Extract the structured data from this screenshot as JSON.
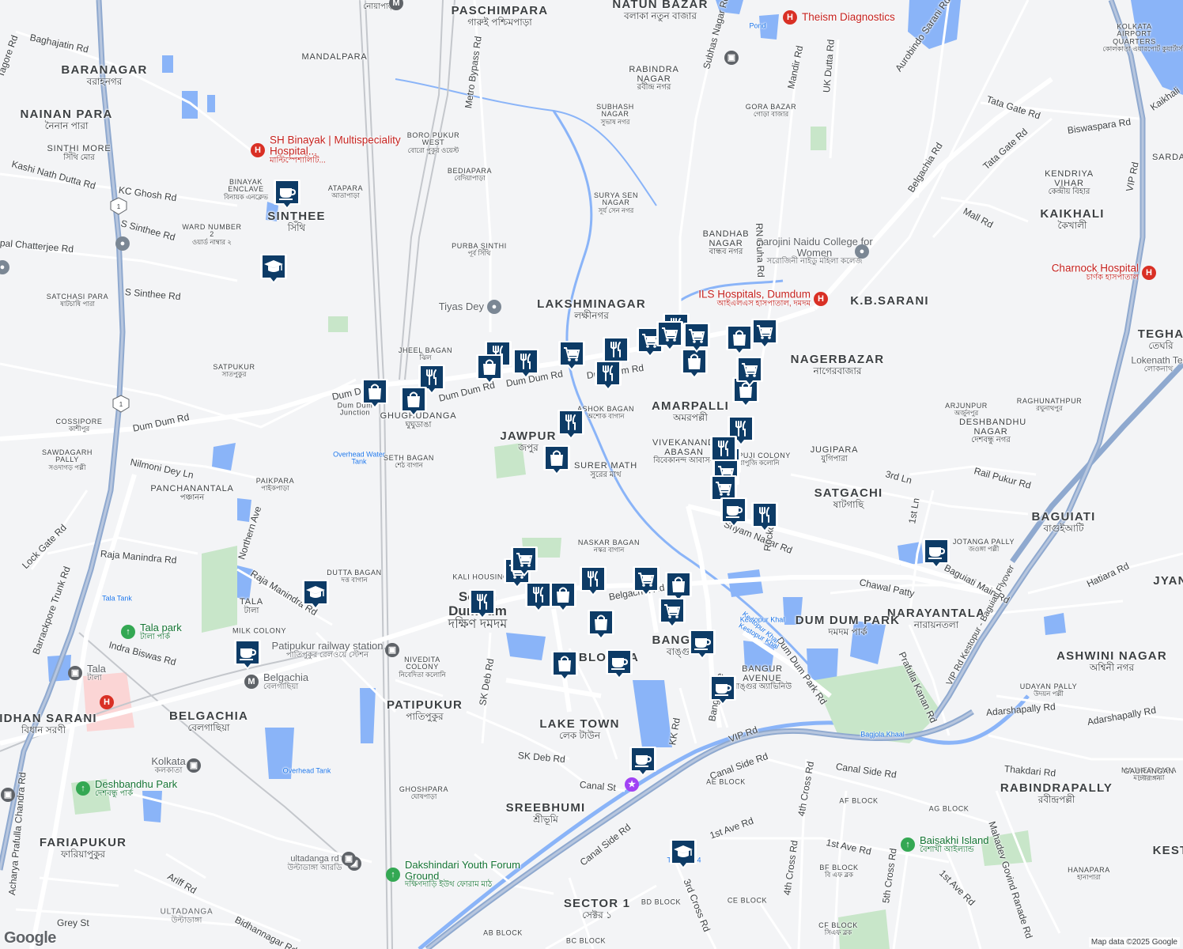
{
  "map": {
    "attribution": "Map data ©2025 Google",
    "logo": "Google",
    "colors": {
      "land": "#f3f4f6",
      "water": "#8ab4f8",
      "park": "#c8e6c9",
      "road": "#ffffff",
      "highway": "#8fa9cf",
      "rail": "#c4c7cc",
      "hospital_area": "#fbd5d5",
      "pin": "#0d3b66"
    }
  },
  "labels": [
    {
      "en": "NOAPARA",
      "bn": "নোয়াপাড়া",
      "cls": "mid"
    },
    {
      "en": "PASCHIMPARA",
      "bn": "গারুই পশ্চিমপাড়া",
      "cls": "big2"
    },
    {
      "en": "NATUN BAZAR",
      "bn": "বলাকা নতুন বাজার",
      "cls": "big"
    },
    {
      "en": "BARANAGAR",
      "bn": "বরাহনগর",
      "cls": "big"
    },
    {
      "en": "MANDALPARA",
      "bn": "",
      "cls": "mid"
    },
    {
      "en": "NAINAN PARA",
      "bn": "নৈনান পারা",
      "cls": "big"
    },
    {
      "en": "SINTHI MORE",
      "bn": "সিঁথি মোর",
      "cls": "mid"
    },
    {
      "en": "BINAYAK ENCLAVE",
      "bn": "বিনায়ক এনক্লেভ",
      "cls": "small"
    },
    {
      "en": "ATAPARA",
      "bn": "আতাপাড়া",
      "cls": "small"
    },
    {
      "en": "SINTHEE",
      "bn": "সিঁথি",
      "cls": "big"
    },
    {
      "en": "WARD NUMBER 2",
      "bn": "ওয়ার্ড নাম্বার ২",
      "cls": "small"
    },
    {
      "en": "SATCHASI PARA",
      "bn": "ষাটচাষি পারা",
      "cls": "small"
    },
    {
      "en": "SATPUKUR",
      "bn": "সাতপুকুর",
      "cls": "small"
    },
    {
      "en": "COSSIPORE",
      "bn": "কাশীপুর",
      "cls": "small"
    },
    {
      "en": "SAWDAGARH PALLY",
      "bn": "সওদাগড় পল্লী",
      "cls": "small"
    },
    {
      "en": "PANCHANANTALA",
      "bn": "পঞ্চানন",
      "cls": "mid"
    },
    {
      "en": "PAIKPARA",
      "bn": "পাইকপাড়া",
      "cls": "small"
    },
    {
      "en": "DUTTA BAGAN",
      "bn": "দত্ত বাগান",
      "cls": "small"
    },
    {
      "en": "TALA",
      "bn": "টালা",
      "cls": "mid"
    },
    {
      "en": "BELGACHIA",
      "bn": "বেলগাছিয়া",
      "cls": "big"
    },
    {
      "en": "BIDHAN SARANI",
      "bn": "বিধান সরণী",
      "cls": "big"
    },
    {
      "en": "FARIAPUKUR",
      "bn": "ফারিয়াপুকুর",
      "cls": "big"
    },
    {
      "en": "PATIPUKUR",
      "bn": "পাতিপুকুর",
      "cls": "big"
    },
    {
      "en": "NIVEDITA COLONY",
      "bn": "নিবেদিতা কলোনি",
      "cls": "small"
    },
    {
      "en": "GHOSHPARA",
      "bn": "ঘোষপাড়া",
      "cls": "small"
    },
    {
      "en": "SREEBHUMI",
      "bn": "শ্রীভূমি",
      "cls": "big"
    },
    {
      "en": "LAKE TOWN",
      "bn": "লেক টাউন",
      "cls": "big"
    },
    {
      "en": "SECTOR 1",
      "bn": "সেক্টর ১",
      "cls": "big"
    },
    {
      "en": "South Dumdum",
      "bn": "দক্ষিণ দমদম",
      "cls": "town"
    },
    {
      "en": "KALI HOUSING",
      "bn": "",
      "cls": "small"
    },
    {
      "en": "NASKAR BAGAN",
      "bn": "নস্কর বাগান",
      "cls": "small"
    },
    {
      "en": "BANGUR AVENUE",
      "bn": "বাঙ্গুর অ্যাভিনিউ",
      "cls": "mid"
    },
    {
      "en": "BLOCK A",
      "bn": "",
      "cls": "big"
    },
    {
      "en": "BANGUR",
      "bn": "বাঙ্গুর",
      "cls": "big"
    },
    {
      "en": "SURER MATH",
      "bn": "সুরের মাথ",
      "cls": "mid"
    },
    {
      "en": "VIVEKANANDA ABASAN",
      "bn": "বিবেকানন্দ আবাসন",
      "cls": "mid"
    },
    {
      "en": "JAWPUR",
      "bn": "জপুর",
      "cls": "big"
    },
    {
      "en": "AMARPALLI",
      "bn": "অমরপল্লী",
      "cls": "big"
    },
    {
      "en": "BAPUJI COLONY",
      "bn": "বাপুজি কলোনি",
      "cls": "small"
    },
    {
      "en": "SATGACHI",
      "bn": "ষাটগাছি",
      "cls": "big"
    },
    {
      "en": "JUGIPARA",
      "bn": "যুগিপারা",
      "cls": "mid"
    },
    {
      "en": "NAGERBAZAR",
      "bn": "নাগেরবাজার",
      "cls": "big"
    },
    {
      "en": "ARJUNPUR",
      "bn": "অর্জুনপুর",
      "cls": "small"
    },
    {
      "en": "K.B.SARANI",
      "bn": "",
      "cls": "big"
    },
    {
      "en": "LAKSHMINAGAR",
      "bn": "লক্ষীনগর",
      "cls": "big"
    },
    {
      "en": "BANDHAB NAGAR",
      "bn": "বান্ধব নগর",
      "cls": "mid"
    },
    {
      "en": "PURBA SINTHI",
      "bn": "পূর্ব সিঁথি",
      "cls": "small"
    },
    {
      "en": "SURYA SEN NAGAR",
      "bn": "সূর্য সেন নগর",
      "cls": "small"
    },
    {
      "en": "BEDIAPARA",
      "bn": "বেদিয়াপাড়া",
      "cls": "small"
    },
    {
      "en": "BORO PUKUR WEST",
      "bn": "বোরো পুকুর ওয়েস্ট",
      "cls": "small"
    },
    {
      "en": "SUBHASH NAGAR",
      "bn": "সুভাষ নগর",
      "cls": "small"
    },
    {
      "en": "RABINDRA NAGAR",
      "bn": "রবীন্দ্র নগর",
      "cls": "mid"
    },
    {
      "en": "GORA BAZAR",
      "bn": "গোড়া বাজার",
      "cls": "small"
    },
    {
      "en": "JHEEL BAGAN",
      "bn": "ঝিল",
      "cls": "small"
    },
    {
      "en": "GHUGHUDANGA",
      "bn": "ঘুঘুডাঙা",
      "cls": "mid"
    },
    {
      "en": "SETH BAGAN",
      "bn": "শেঠ বাগান",
      "cls": "small"
    },
    {
      "en": "ASHOK BAGAN",
      "bn": "অশোক বাগান",
      "cls": "small"
    },
    {
      "en": "RAGHUNATHPUR",
      "bn": "রঘুনাথপুর",
      "cls": "small"
    },
    {
      "en": "DESHBANDHU NAGAR",
      "bn": "দেশবন্ধু নগর",
      "cls": "mid"
    },
    {
      "en": "BAGUIATI",
      "bn": "বাগুইআটি",
      "cls": "big"
    },
    {
      "en": "JOTANGA PALLY",
      "bn": "জওঙ্গা পল্লী",
      "cls": "small"
    },
    {
      "en": "NARAYANTALA",
      "bn": "নারায়নতলা",
      "cls": "big"
    },
    {
      "en": "DUM DUM PARK",
      "bn": "দমদম পার্ক",
      "cls": "big"
    },
    {
      "en": "ASHWINI NAGAR",
      "bn": "অশ্বিনী নগর",
      "cls": "big"
    },
    {
      "en": "UDAYAN PALLY",
      "bn": "উদয়ন পল্লী",
      "cls": "small"
    },
    {
      "en": "RABINDRAPALLY",
      "bn": "রবীন্দ্রপল্লী",
      "cls": "big"
    },
    {
      "en": "MAJHER PARA",
      "bn": "মাঝের পারা",
      "cls": "small"
    },
    {
      "en": "GAURANGAN",
      "bn": "গৌরাঙ্গন",
      "cls": "small"
    },
    {
      "en": "HANAPARA",
      "bn": "হানাপারা",
      "cls": "small"
    },
    {
      "en": "KOLKATA AIRPORT QUARTERS",
      "bn": "কোলকাতা এয়ারপোর্ট কুয়ার্টার্স",
      "cls": "small"
    },
    {
      "en": "KENDRIYA VIHAR",
      "bn": "কেন্দ্রীয় বিহার",
      "cls": "mid"
    },
    {
      "en": "KAIKHALI",
      "bn": "কৈখালী",
      "cls": "big"
    },
    {
      "en": "TEGHA",
      "bn": "তেঘরি",
      "cls": "big"
    },
    {
      "en": "Lokenath Ter",
      "bn": "লোকনাথ",
      "cls": "poiplain"
    },
    {
      "en": "SARDA",
      "bn": "",
      "cls": "mid"
    },
    {
      "en": "JYAN",
      "bn": "",
      "cls": "big"
    },
    {
      "en": "KEST",
      "bn": "",
      "cls": "big"
    },
    {
      "en": "AE BLOCK",
      "bn": "",
      "cls": "small"
    },
    {
      "en": "AF BLOCK",
      "bn": "",
      "cls": "small"
    },
    {
      "en": "AG BLOCK",
      "bn": "",
      "cls": "small"
    },
    {
      "en": "BF BLOCK",
      "bn": "বি এফ ব্লক",
      "cls": "small"
    },
    {
      "en": "BD BLOCK",
      "bn": "",
      "cls": "small"
    },
    {
      "en": "CE BLOCK",
      "bn": "",
      "cls": "small"
    },
    {
      "en": "BC BLOCK",
      "bn": "",
      "cls": "small"
    },
    {
      "en": "AB BLOCK",
      "bn": "",
      "cls": "small"
    },
    {
      "en": "CF BLOCK",
      "bn": "সিএফ ব্লক",
      "cls": "small"
    },
    {
      "en": "MILK COLONY",
      "bn": "",
      "cls": "small"
    },
    {
      "en": "Overhead Water Tank",
      "bn": "",
      "cls": "water"
    },
    {
      "en": "Overhead Tank",
      "bn": "",
      "cls": "water"
    },
    {
      "en": "Tala Tank",
      "bn": "",
      "cls": "water"
    },
    {
      "en": "Tank No. 4",
      "bn": "",
      "cls": "water"
    },
    {
      "en": "Pond",
      "bn": "",
      "cls": "water"
    },
    {
      "en": "Bagjola Khaal",
      "bn": "",
      "cls": "water"
    },
    {
      "en": "Kestopur Khal",
      "bn": "",
      "cls": "water"
    },
    {
      "en": "Dum Dum Junction",
      "bn": "",
      "cls": "tinystation"
    }
  ],
  "pois": [
    {
      "name": "Theism Diagnostics",
      "bn": "",
      "cls": "hosp left"
    },
    {
      "name": "SH Binayak | Multispeciality Hospital...",
      "bn": "মাল্টিস্পেশালিটি...",
      "cls": "hosp left"
    },
    {
      "name": "Sarojini Naidu College for Women",
      "bn": "সরোজিনী নাইডু মহিলা কলেজ",
      "cls": "poi"
    },
    {
      "name": "ILS Hospitals, Dumdum",
      "bn": "আইএলএস হাসপাতাল, দমদম",
      "cls": "hosp right"
    },
    {
      "name": "Charnock Hospital",
      "bn": "চার্ণক হাসপাতাল",
      "cls": "hosp right"
    },
    {
      "name": "Tiyas Dey",
      "bn": "",
      "cls": "poi right"
    },
    {
      "name": "Tala park",
      "bn": "টালা পার্ক",
      "cls": "park left"
    },
    {
      "name": "Patipukur railway station",
      "bn": "পাতিপুকুর রেলওয়ে স্টেশন",
      "cls": "poi"
    },
    {
      "name": "Belgachia",
      "bn": "বেলগাছিয়া",
      "cls": "poi left"
    },
    {
      "name": "Tala",
      "bn": "টালা",
      "cls": "poi left"
    },
    {
      "name": "Kolkata",
      "bn": "কলকাতা",
      "cls": "poi"
    },
    {
      "name": "Deshbandhu Park",
      "bn": "দেশবন্ধু পার্ক",
      "cls": "park left"
    },
    {
      "name": "Dakshindari Youth Forum Ground",
      "bn": "দক্ষিণদাড়ি ইউথ ফোরাম মাঠ",
      "cls": "park left"
    },
    {
      "name": "ultadanga rd",
      "bn": "উল্টাডাঙ্গা আরডি",
      "cls": "poi"
    },
    {
      "name": "ULTADANGA",
      "bn": "উল্টাডাঙ্গা",
      "cls": "poi"
    },
    {
      "name": "Baisakhi Island",
      "bn": "বৈশাখী আইল্যান্ড",
      "cls": "park left"
    }
  ],
  "roads": [
    "Baghajatin Rd",
    "Tagore Rd",
    "Kashi Nath Dutta Rd",
    "KC Ghosh Rd",
    "S Sinthee Rd",
    "pal Chatterjee Rd",
    "S Sinthee Rd",
    "Dum Dum Rd",
    "Dum Dum Rd",
    "Dum Dum Rd",
    "Nilmoni Dey Ln",
    "Lock Gate Rd",
    "Raja Manindra Rd",
    "Raja Manindra Rd",
    "Northern Ave",
    "Barrackpore Trunk Rd",
    "Indra Biswas Rd",
    "Metro Bypass Rd",
    "Subhas Nagar Rd",
    "Mandir Rd",
    "UK Dutta Rd",
    "Aurobindo Sarani Rd",
    "Belgachia Rd",
    "RN Guha Rd",
    "Tata Gate Rd",
    "Tata Gate Rd",
    "Biswaspara Rd",
    "Mall Rd",
    "VIP Rd",
    "Kaikhali",
    "Rail Pukur Rd",
    "3rd Ln",
    "1st Ln",
    "Shyam Nagar Rd",
    "Rockol Rd",
    "Chawal Patty",
    "Baguiati Main Rd",
    "Hatiara Rd",
    "Prafulla Kanan Rd",
    "Dum Dum Park Rd",
    "Adarshapally Rd",
    "Adarshapally Rd",
    "Thakdari Rd",
    "Canal Side Rd",
    "Canal Side Rd",
    "Canal Side Rd",
    "VIP Rd",
    "Canal St",
    "SK Deb Rd",
    "SK Deb Rd",
    "Belgachia Rd",
    "Kestopur Khal",
    "4th Cross Rd",
    "4th Cross Rd",
    "5th Cross Rd",
    "3rd Cross Rd",
    "1st Ave Rd",
    "1st Ave Rd",
    "1st Ave Rd",
    "Mahadev Govind Ranade Rd",
    "Grey St",
    "Bidhannagar Rd",
    "Ariff Rd",
    "Acharya Prafulla Chandra Rd",
    "KK Rd",
    "Bangur Ave",
    "VIP Rd Kestopur - Baguiati Flyover",
    "Kestopur Khal",
    "Nivedita",
    "Dumdum Rd",
    "Belgac",
    "Ma",
    "Dum Dum Rd",
    "Dum Dum Rd"
  ],
  "markers": [
    {
      "icon": "restaurant-icon"
    },
    {
      "icon": "restaurant-icon"
    },
    {
      "icon": "restaurant-icon"
    },
    {
      "icon": "restaurant-icon"
    },
    {
      "icon": "restaurant-icon"
    },
    {
      "icon": "restaurant-icon"
    },
    {
      "icon": "restaurant-icon"
    },
    {
      "icon": "restaurant-icon"
    },
    {
      "icon": "restaurant-icon"
    },
    {
      "icon": "restaurant-icon"
    },
    {
      "icon": "restaurant-icon"
    },
    {
      "icon": "restaurant-icon"
    },
    {
      "icon": "restaurant-icon"
    },
    {
      "icon": "restaurant-icon"
    },
    {
      "icon": "shopping-bag-icon"
    },
    {
      "icon": "shopping-bag-icon"
    },
    {
      "icon": "shopping-bag-icon"
    },
    {
      "icon": "shopping-bag-icon"
    },
    {
      "icon": "shopping-bag-icon"
    },
    {
      "icon": "shopping-bag-icon"
    },
    {
      "icon": "shopping-bag-icon"
    },
    {
      "icon": "shopping-bag-icon"
    },
    {
      "icon": "shopping-bag-icon"
    },
    {
      "icon": "shopping-bag-icon"
    },
    {
      "icon": "shopping-bag-icon"
    },
    {
      "icon": "cart-icon"
    },
    {
      "icon": "cart-icon"
    },
    {
      "icon": "cart-icon"
    },
    {
      "icon": "cart-icon"
    },
    {
      "icon": "cart-icon"
    },
    {
      "icon": "cart-icon"
    },
    {
      "icon": "cart-icon"
    },
    {
      "icon": "cart-icon"
    },
    {
      "icon": "cart-icon"
    },
    {
      "icon": "cart-icon"
    },
    {
      "icon": "cart-icon"
    },
    {
      "icon": "cart-icon"
    },
    {
      "icon": "cafe-icon"
    },
    {
      "icon": "cafe-icon"
    },
    {
      "icon": "cafe-icon"
    },
    {
      "icon": "cafe-icon"
    },
    {
      "icon": "cafe-icon"
    },
    {
      "icon": "cafe-icon"
    },
    {
      "icon": "cafe-icon"
    },
    {
      "icon": "cafe-icon"
    },
    {
      "icon": "school-icon"
    },
    {
      "icon": "school-icon"
    },
    {
      "icon": "school-icon"
    }
  ]
}
